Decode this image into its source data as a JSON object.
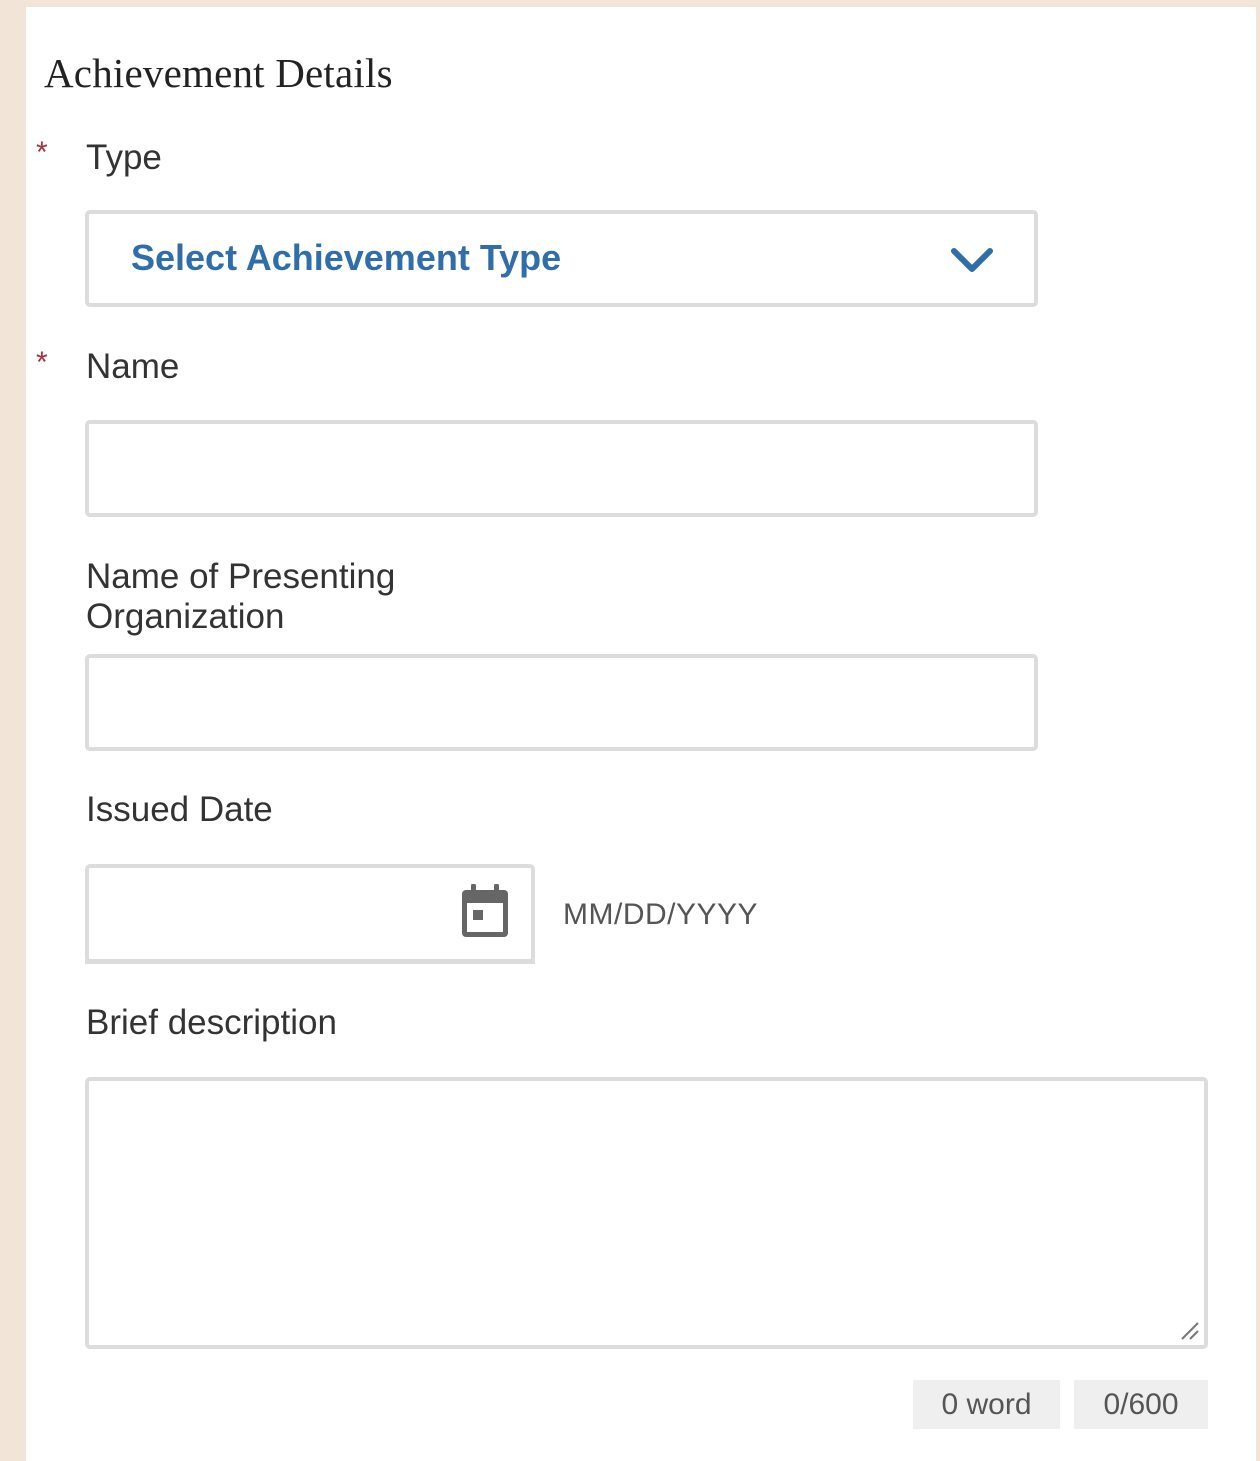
{
  "form": {
    "section_title": "Achievement Details",
    "required_marker": "*",
    "type": {
      "label": "Type",
      "required": true,
      "selected_value": "Select Achievement Type",
      "icon": "chevron-down-icon"
    },
    "name": {
      "label": "Name",
      "required": true,
      "value": ""
    },
    "organization": {
      "label": "Name of Presenting Organization",
      "required": false,
      "value": ""
    },
    "issued_date": {
      "label": "Issued Date",
      "required": false,
      "value": "",
      "format_hint": "MM/DD/YYYY",
      "icon": "calendar-icon"
    },
    "description": {
      "label": "Brief description",
      "required": false,
      "value": "",
      "word_count": "0 word",
      "char_count": "0/600"
    }
  },
  "colors": {
    "page_background": "#f2e4d7",
    "panel_background": "#ffffff",
    "required_star": "#a4323d",
    "select_text": "#2f6ea8",
    "field_border": "#dcdcdc",
    "counter_background": "#efefef",
    "icon_gray": "#666666"
  }
}
